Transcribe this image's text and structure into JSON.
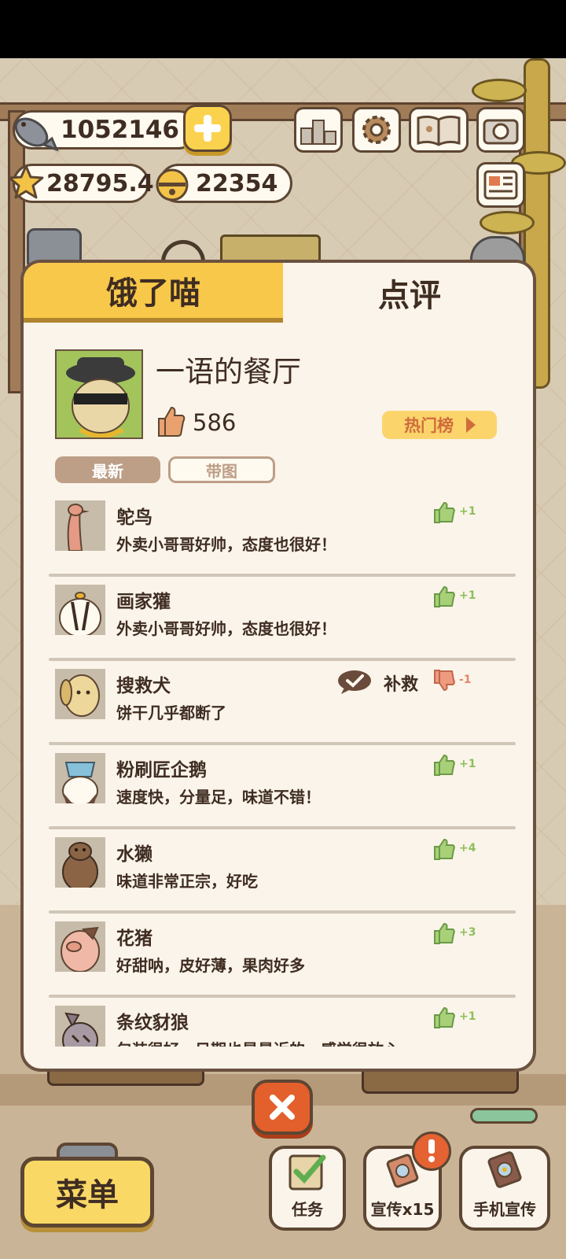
{
  "hud": {
    "fish": "1052146",
    "stars": "28795.4",
    "bells": "22354"
  },
  "panel": {
    "tabs": [
      "饿了喵",
      "点评"
    ],
    "restaurant_name": "一语的餐厅",
    "likes": "586",
    "hot_button": "热门榜",
    "filters": [
      "最新",
      "带图"
    ]
  },
  "reviews": [
    {
      "name": "鸵鸟",
      "text": "外卖小哥哥好帅，态度也很好！",
      "score": "+1",
      "positive": true,
      "avatar": "ostrich"
    },
    {
      "name": "画家獾",
      "text": "外卖小哥哥好帅，态度也很好！",
      "score": "+1",
      "positive": true,
      "avatar": "badger"
    },
    {
      "name": "搜救犬",
      "text": "饼干几乎都断了",
      "score": "-1",
      "positive": false,
      "remedy": "补救",
      "avatar": "dog"
    },
    {
      "name": "粉刷匠企鹅",
      "text": "速度快，分量足，味道不错！",
      "score": "+1",
      "positive": true,
      "avatar": "penguin"
    },
    {
      "name": "水獭",
      "text": "味道非常正宗，好吃",
      "score": "+4",
      "positive": true,
      "avatar": "otter"
    },
    {
      "name": "花猪",
      "text": "好甜呐，皮好薄，果肉好多",
      "score": "+3",
      "positive": true,
      "avatar": "pig"
    },
    {
      "name": "条纹豺狼",
      "text": "包装很好，日期也是最近的，感觉很放心",
      "score": "+1",
      "positive": true,
      "avatar": "jackal"
    }
  ],
  "bottom": {
    "menu": "菜单",
    "task": "任务",
    "promo": "宣传x15",
    "phone_promo": "手机宣传"
  },
  "colors": {
    "accent": "#f8c84a",
    "panel": "#fbf4ea",
    "border": "#6b5140",
    "close": "#e35f2b",
    "positive": "#8cbf5c",
    "negative": "#e0886a"
  }
}
